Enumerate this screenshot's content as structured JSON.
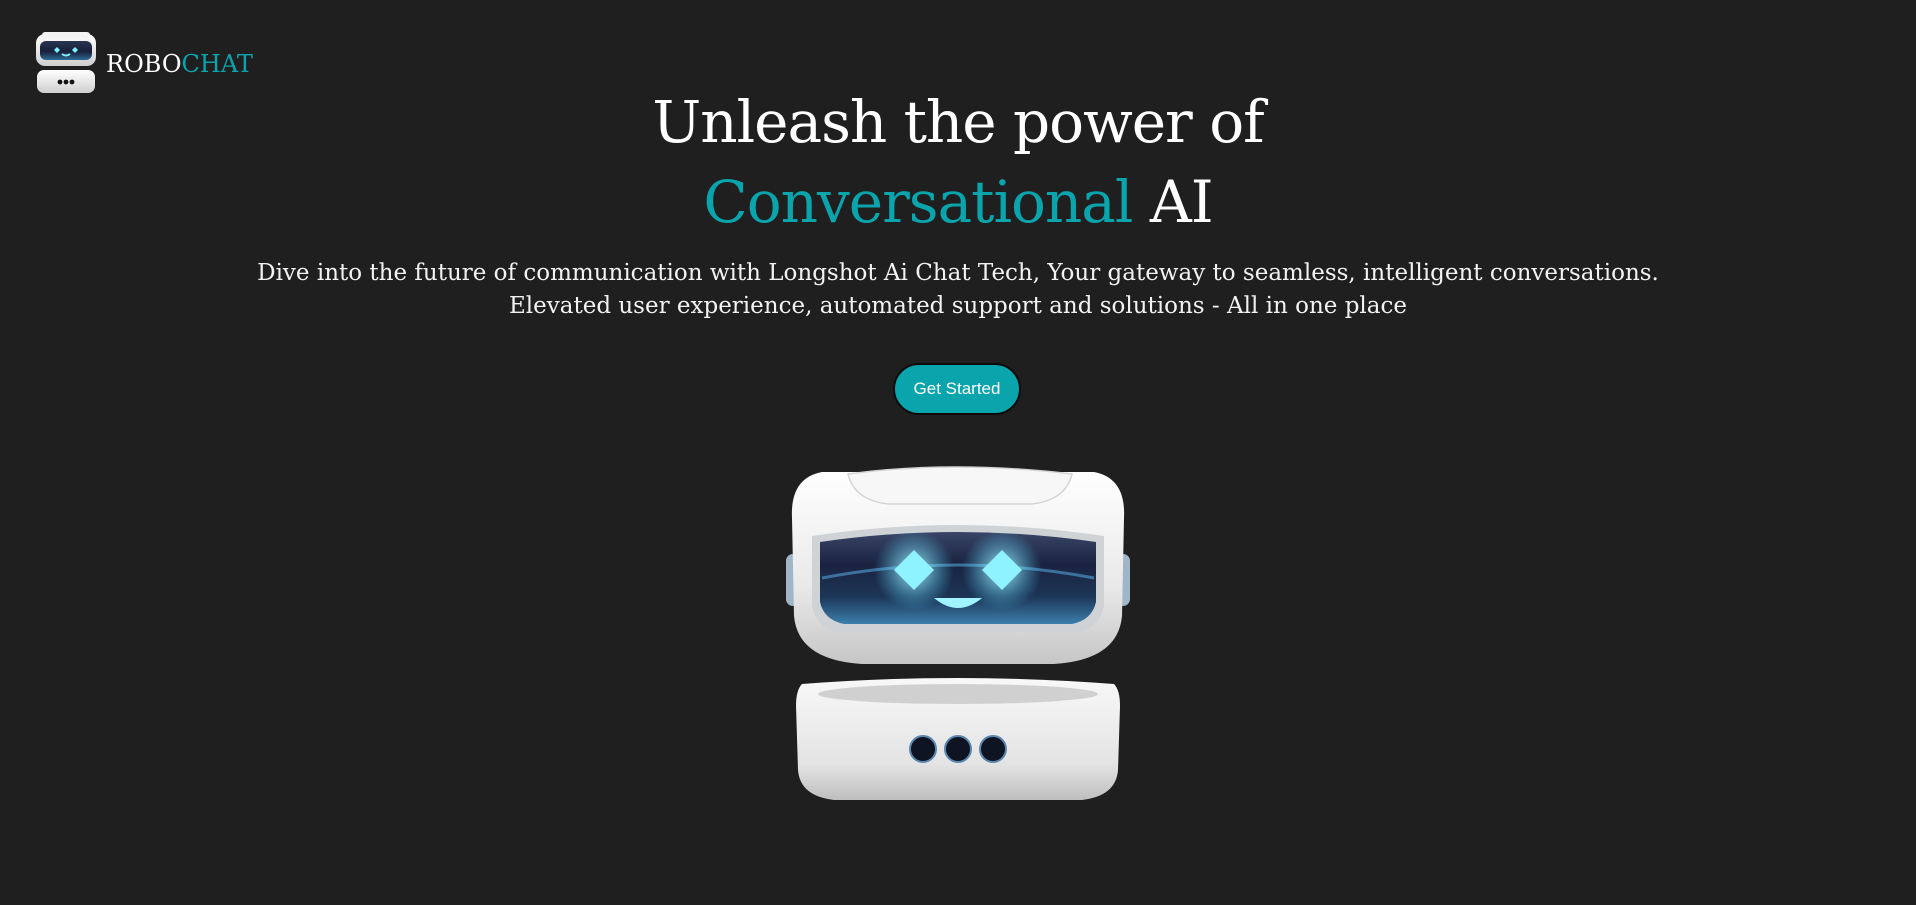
{
  "brand": {
    "name_part1": "ROBO",
    "name_part2": "CHAT",
    "logo_icon": "robot-head-icon"
  },
  "hero": {
    "title_line1": "Unleash the power of",
    "title_accent": "Conversational",
    "title_tail": " AI",
    "subtitle_line1": "Dive into the future of communication with Longshot Ai Chat Tech, Your gateway to seamless, intelligent conversations.",
    "subtitle_line2": "Elevated user experience, automated support and solutions - All in one place",
    "cta_label": "Get Started",
    "illustration": "robot-mascot-illustration"
  },
  "colors": {
    "background": "#1f1f1f",
    "accent": "#0aa4ad",
    "text": "#ffffff"
  }
}
